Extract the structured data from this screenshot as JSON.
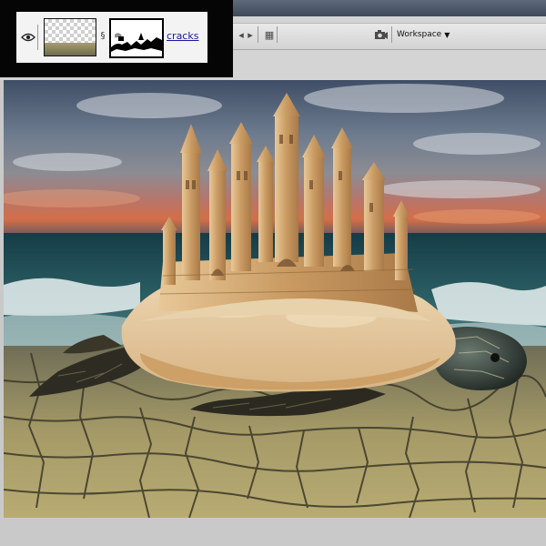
{
  "toolbar": {
    "workspace_label": "Workspace",
    "workspace_menu_icon": "triangle-down-icon",
    "icons": [
      "nav-back-icon",
      "nav-forward-icon",
      "arrange-icon",
      "camera-icon"
    ]
  },
  "layers": {
    "layer_name": "cracks",
    "visibility_icon": "eye-icon",
    "link_icon": "chain-link-icon"
  },
  "canvas": {
    "description_colors": {
      "sky_top": "#4a5a73",
      "sunset": "#c35a3a",
      "sea": "#1f4a52",
      "sand_castle": "#d2b07d",
      "cracked_ground": "#9a9060"
    }
  }
}
